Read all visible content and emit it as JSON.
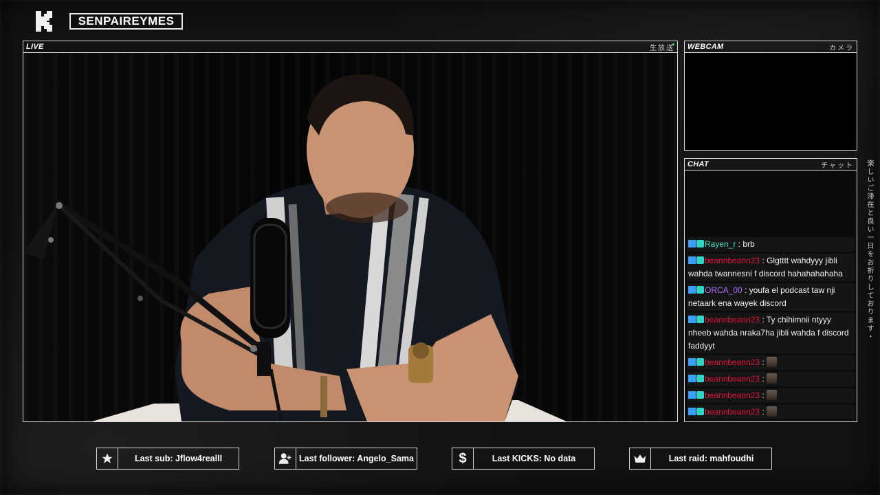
{
  "header": {
    "channel_name": "SENPAIREYMES",
    "logo_icon": "kick-logo-icon"
  },
  "panels": {
    "live": {
      "title": "LIVE",
      "jp": "生放送"
    },
    "webcam": {
      "title": "WEBCAM",
      "jp": "カメラ"
    },
    "chat": {
      "title": "CHAT",
      "jp": "チャット"
    }
  },
  "side_text": "楽しいご滞在と良い一日をお祈りしております・",
  "chat": {
    "messages": [
      {
        "user": "Rayen_r",
        "color": "#4ce0c4",
        "text": " : brb"
      },
      {
        "user": "beannbeann23",
        "color": "#e0143c",
        "text": " : Glgtttt wahdyyy jibli wahda twannesni f discord hahahahahaha"
      },
      {
        "user": "ORCA_00",
        "color": "#b070ff",
        "text": " : youfa el podcast taw nji netaark ena wayek discord"
      },
      {
        "user": "beannbeann23",
        "color": "#e0143c",
        "text": " : Ty chihimnii ntyyy nheeb wahda nraka7ha jibli wahda f discord faddyyt"
      },
      {
        "user": "beannbeann23",
        "color": "#e0143c",
        "text": " : "
      },
      {
        "user": "beannbeann23",
        "color": "#e0143c",
        "text": " : "
      },
      {
        "user": "beannbeann23",
        "color": "#e0143c",
        "text": " : "
      },
      {
        "user": "beannbeann23",
        "color": "#e0143c",
        "text": " : "
      }
    ]
  },
  "stats": [
    {
      "icon": "star-icon",
      "label": "Last sub: Jflow4realll"
    },
    {
      "icon": "user-plus-icon",
      "label": "Last follower: Angelo_Sama"
    },
    {
      "icon": "dollar-icon",
      "label": "Last KICKS: No data"
    },
    {
      "icon": "crown-icon",
      "label": "Last raid: mahfoudhi"
    }
  ]
}
